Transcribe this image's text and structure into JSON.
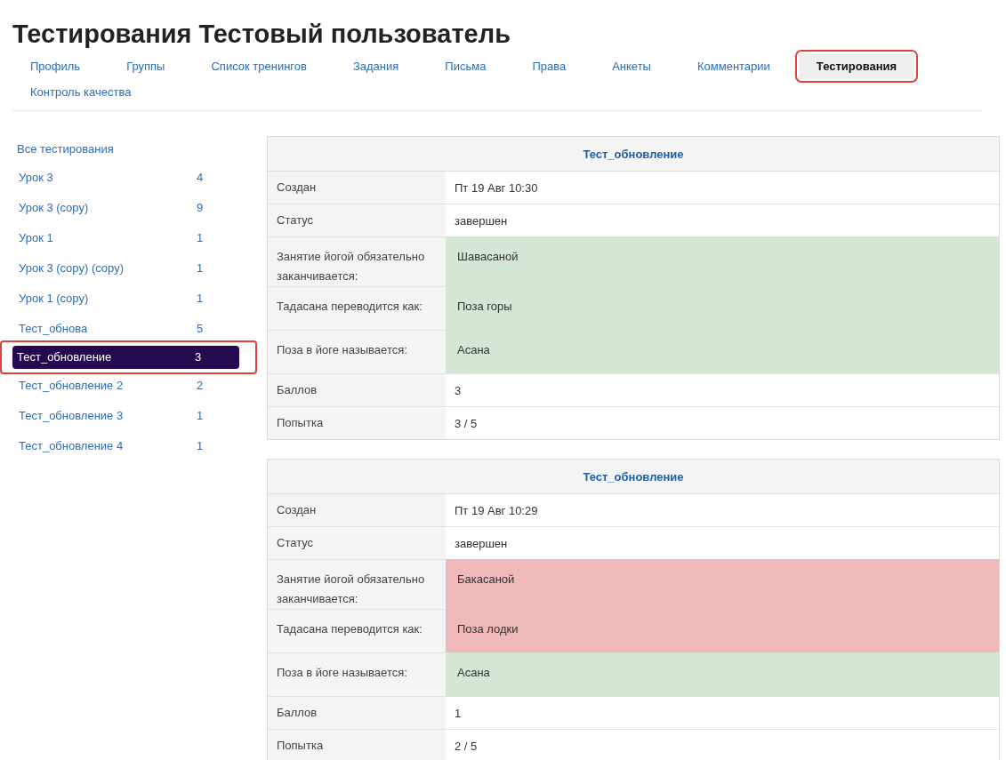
{
  "page_title": "Тестирования Тестовый пользователь",
  "tabs": [
    {
      "label": "Профиль",
      "selected": false,
      "highlighted": false
    },
    {
      "label": "Группы",
      "selected": false,
      "highlighted": false
    },
    {
      "label": "Список тренингов",
      "selected": false,
      "highlighted": false
    },
    {
      "label": "Задания",
      "selected": false,
      "highlighted": false
    },
    {
      "label": "Письма",
      "selected": false,
      "highlighted": false
    },
    {
      "label": "Права",
      "selected": false,
      "highlighted": false
    },
    {
      "label": "Анкеты",
      "selected": false,
      "highlighted": false
    },
    {
      "label": "Комментарии",
      "selected": false,
      "highlighted": false
    },
    {
      "label": "Тестирования",
      "selected": true,
      "highlighted": true
    },
    {
      "label": "Контроль качества",
      "selected": false,
      "highlighted": false
    }
  ],
  "sidebar": {
    "all_label": "Все тестирования",
    "items": [
      {
        "name": "Урок 3",
        "count": "4",
        "selected": false,
        "highlighted": false
      },
      {
        "name": "Урок 3 (copy)",
        "count": "9",
        "selected": false,
        "highlighted": false
      },
      {
        "name": "Урок 1",
        "count": "1",
        "selected": false,
        "highlighted": false
      },
      {
        "name": "Урок 3 (copy) (copy)",
        "count": "1",
        "selected": false,
        "highlighted": false
      },
      {
        "name": "Урок 1 (copy)",
        "count": "1",
        "selected": false,
        "highlighted": false
      },
      {
        "name": "Тест_обнова",
        "count": "5",
        "selected": false,
        "highlighted": false
      },
      {
        "name": "Тест_обновление",
        "count": "3",
        "selected": true,
        "highlighted": true
      },
      {
        "name": "Тест_обновление 2",
        "count": "2",
        "selected": false,
        "highlighted": false
      },
      {
        "name": "Тест_обновление 3",
        "count": "1",
        "selected": false,
        "highlighted": false
      },
      {
        "name": "Тест_обновление 4",
        "count": "1",
        "selected": false,
        "highlighted": false
      }
    ]
  },
  "results": [
    {
      "title": "Тест_обновление",
      "rows": [
        {
          "kind": "info",
          "label": "Создан",
          "value": "Пт 19 Авг 10:30"
        },
        {
          "kind": "info",
          "label": "Статус",
          "value": "завершен"
        },
        {
          "kind": "answer",
          "label": "Занятие йогой обязательно заканчивается:",
          "value": "Шавасаной",
          "correct": true
        },
        {
          "kind": "answer",
          "label": "Тадасана переводится как:",
          "value": "Поза горы",
          "correct": true
        },
        {
          "kind": "answer",
          "label": "Поза в йоге называется:",
          "value": "Асана",
          "correct": true
        },
        {
          "kind": "info",
          "label": "Баллов",
          "value": "3"
        },
        {
          "kind": "info",
          "label": "Попытка",
          "value": "3 / 5"
        }
      ]
    },
    {
      "title": "Тест_обновление",
      "rows": [
        {
          "kind": "info",
          "label": "Создан",
          "value": "Пт 19 Авг 10:29"
        },
        {
          "kind": "info",
          "label": "Статус",
          "value": "завершен"
        },
        {
          "kind": "answer",
          "label": "Занятие йогой обязательно заканчивается:",
          "value": "Бакасаной",
          "correct": false
        },
        {
          "kind": "answer",
          "label": "Тадасана переводится как:",
          "value": "Поза лодки",
          "correct": false
        },
        {
          "kind": "answer",
          "label": "Поза в йоге называется:",
          "value": "Асана",
          "correct": true
        },
        {
          "kind": "info",
          "label": "Баллов",
          "value": "1"
        },
        {
          "kind": "info",
          "label": "Попытка",
          "value": "2 / 5"
        }
      ]
    }
  ]
}
